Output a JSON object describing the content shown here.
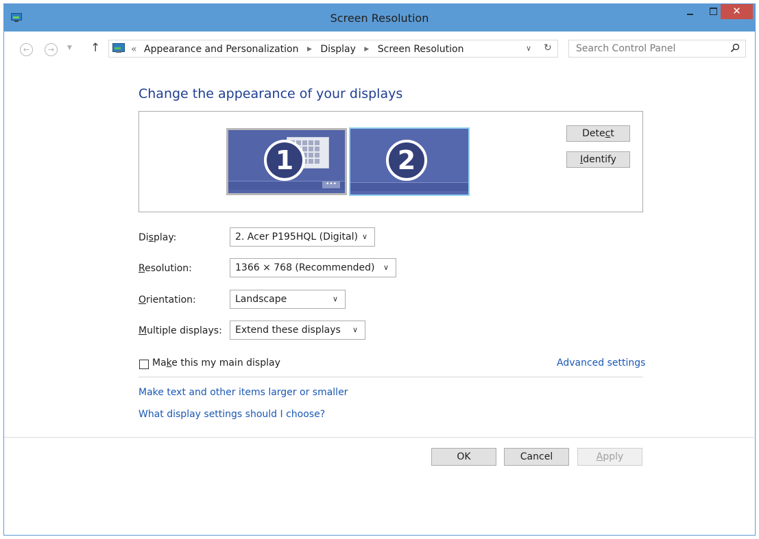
{
  "window": {
    "title": "Screen Resolution",
    "close_glyph": "✕"
  },
  "nav": {
    "back_glyph": "←",
    "forward_glyph": "→",
    "recent_glyph": "▼",
    "up_glyph": "↑",
    "crumb_prefix": "«",
    "breadcrumbs": [
      "Appearance and Personalization",
      "Display",
      "Screen Resolution"
    ],
    "crumb_sep": "▶",
    "dropdown_glyph": "∨",
    "refresh_glyph": "↻",
    "search_placeholder": "Search Control Panel"
  },
  "heading": "Change the appearance of your displays",
  "preview": {
    "monitor1_number": "1",
    "monitor2_number": "2",
    "more_glyph": "•••",
    "detect_label": {
      "pre": "Dete",
      "ul": "c",
      "post": "t"
    },
    "identify_label": {
      "pre": "",
      "ul": "I",
      "post": "dentify"
    }
  },
  "fields": {
    "display": {
      "label_pre": "Di",
      "label_ul": "s",
      "label_post": "play:",
      "value": "2. Acer P195HQL (Digital)"
    },
    "resolution": {
      "label_pre": "",
      "label_ul": "R",
      "label_post": "esolution:",
      "value": "1366 × 768 (Recommended)"
    },
    "orientation": {
      "label_pre": "",
      "label_ul": "O",
      "label_post": "rientation:",
      "value": "Landscape"
    },
    "multiple": {
      "label_pre": "",
      "label_ul": "M",
      "label_post": "ultiple displays:",
      "value": "Extend these displays"
    },
    "chevron": "∨"
  },
  "main_display": {
    "label_pre": "Ma",
    "label_ul": "k",
    "label_post": "e this my main display",
    "checked": false
  },
  "links": {
    "advanced": "Advanced settings",
    "text_size": "Make text and other items larger or smaller",
    "which_settings": "What display settings should I choose?"
  },
  "buttons": {
    "ok": "OK",
    "cancel": "Cancel",
    "apply_ul": "A",
    "apply_post": "pply"
  },
  "colors": {
    "titlebar": "#5b9bd5",
    "close_button": "#c7504a",
    "heading": "#1e3e92",
    "link": "#1a57b4",
    "monitor": "#5364a8",
    "selected_monitor_border": "#8fd0f2"
  },
  "icons": [
    "control-panel-icon",
    "back-icon",
    "forward-icon",
    "up-arrow-icon",
    "refresh-icon",
    "search-icon",
    "chevron-down-icon"
  ]
}
